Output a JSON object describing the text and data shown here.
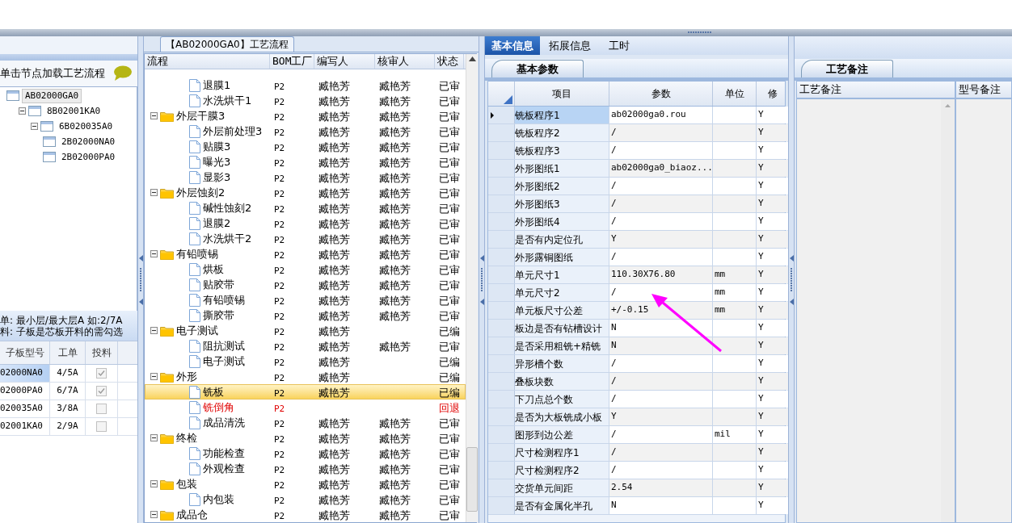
{
  "bom_tree": {
    "hint": "单击节点加载工艺流程",
    "nodes": [
      {
        "code": "AB02000GA0",
        "selected": true,
        "children": [
          {
            "code": "8B02001KA0",
            "selected": false,
            "children": [
              {
                "code": "6B020035A0",
                "selected": false,
                "children": [
                  {
                    "code": "2B02000NA0",
                    "selected": false
                  },
                  {
                    "code": "2B02000PA0",
                    "selected": false
                  }
                ]
              }
            ]
          }
        ]
      }
    ]
  },
  "sub_boards": {
    "notes": [
      "单: 最小层/最大层A 如:2/7A",
      "料: 子板是芯板开料的需勾选"
    ],
    "columns": [
      "子板型号",
      "工单",
      "投料"
    ],
    "rows": [
      {
        "model": "02000NA0",
        "order": "4/5A",
        "checked": true
      },
      {
        "model": "02000PA0",
        "order": "6/7A",
        "checked": true
      },
      {
        "model": "020035A0",
        "order": "3/8A",
        "checked": false
      },
      {
        "model": "02001KA0",
        "order": "2/9A",
        "checked": false
      }
    ]
  },
  "process_flow": {
    "title": "【AB02000GA0】工艺流程",
    "columns": [
      "流程",
      "BOM工厂",
      "编写人",
      "核审人",
      "状态"
    ],
    "steps": [
      {
        "kind": "group",
        "children": [
          {
            "kind": "step",
            "name": "退膜1",
            "factory": "P2",
            "writer": "臧艳芳",
            "reviewer": "臧艳芳",
            "status": "已审",
            "selected": false,
            "returned": false
          },
          {
            "kind": "step",
            "name": "水洗烘干1",
            "factory": "P2",
            "writer": "臧艳芳",
            "reviewer": "臧艳芳",
            "status": "已审",
            "selected": false,
            "returned": false
          }
        ]
      },
      {
        "kind": "folder",
        "name": "外层干膜3",
        "factory": "P2",
        "writer": "臧艳芳",
        "reviewer": "臧艳芳",
        "status": "已审",
        "selected": false,
        "returned": false,
        "expanded": true,
        "children": [
          {
            "kind": "step",
            "name": "外层前处理3",
            "factory": "P2",
            "writer": "臧艳芳",
            "reviewer": "臧艳芳",
            "status": "已审",
            "selected": false,
            "returned": false
          },
          {
            "kind": "step",
            "name": "贴膜3",
            "factory": "P2",
            "writer": "臧艳芳",
            "reviewer": "臧艳芳",
            "status": "已审",
            "selected": false,
            "returned": false
          },
          {
            "kind": "step",
            "name": "曝光3",
            "factory": "P2",
            "writer": "臧艳芳",
            "reviewer": "臧艳芳",
            "status": "已审",
            "selected": false,
            "returned": false
          },
          {
            "kind": "step",
            "name": "显影3",
            "factory": "P2",
            "writer": "臧艳芳",
            "reviewer": "臧艳芳",
            "status": "已审",
            "selected": false,
            "returned": false
          }
        ]
      },
      {
        "kind": "folder",
        "name": "外层蚀刻2",
        "factory": "P2",
        "writer": "臧艳芳",
        "reviewer": "臧艳芳",
        "status": "已审",
        "selected": false,
        "returned": false,
        "expanded": true,
        "children": [
          {
            "kind": "step",
            "name": "碱性蚀刻2",
            "factory": "P2",
            "writer": "臧艳芳",
            "reviewer": "臧艳芳",
            "status": "已审",
            "selected": false,
            "returned": false
          },
          {
            "kind": "step",
            "name": "退膜2",
            "factory": "P2",
            "writer": "臧艳芳",
            "reviewer": "臧艳芳",
            "status": "已审",
            "selected": false,
            "returned": false
          },
          {
            "kind": "step",
            "name": "水洗烘干2",
            "factory": "P2",
            "writer": "臧艳芳",
            "reviewer": "臧艳芳",
            "status": "已审",
            "selected": false,
            "returned": false
          }
        ]
      },
      {
        "kind": "folder",
        "name": "有铅喷锡",
        "factory": "P2",
        "writer": "臧艳芳",
        "reviewer": "臧艳芳",
        "status": "已审",
        "selected": false,
        "returned": false,
        "expanded": true,
        "children": [
          {
            "kind": "step",
            "name": "烘板",
            "factory": "P2",
            "writer": "臧艳芳",
            "reviewer": "臧艳芳",
            "status": "已审",
            "selected": false,
            "returned": false
          },
          {
            "kind": "step",
            "name": "贴胶带",
            "factory": "P2",
            "writer": "臧艳芳",
            "reviewer": "臧艳芳",
            "status": "已审",
            "selected": false,
            "returned": false
          },
          {
            "kind": "step",
            "name": "有铅喷锡",
            "factory": "P2",
            "writer": "臧艳芳",
            "reviewer": "臧艳芳",
            "status": "已审",
            "selected": false,
            "returned": false
          },
          {
            "kind": "step",
            "name": "撕胶带",
            "factory": "P2",
            "writer": "臧艳芳",
            "reviewer": "臧艳芳",
            "status": "已审",
            "selected": false,
            "returned": false
          }
        ]
      },
      {
        "kind": "folder",
        "name": "电子测试",
        "factory": "P2",
        "writer": "臧艳芳",
        "status": "已编",
        "selected": false,
        "returned": false,
        "expanded": true,
        "children": [
          {
            "kind": "step",
            "name": "阻抗测试",
            "factory": "P2",
            "writer": "臧艳芳",
            "reviewer": "臧艳芳",
            "status": "已审",
            "selected": false,
            "returned": false
          },
          {
            "kind": "step",
            "name": "电子测试",
            "factory": "P2",
            "writer": "臧艳芳",
            "status": "已编",
            "selected": false,
            "returned": false
          }
        ]
      },
      {
        "kind": "folder",
        "name": "外形",
        "factory": "P2",
        "writer": "臧艳芳",
        "status": "已编",
        "selected": false,
        "returned": false,
        "expanded": true,
        "children": [
          {
            "kind": "step",
            "name": "铣板",
            "factory": "P2",
            "writer": "臧艳芳",
            "status": "已编",
            "selected": true,
            "returned": false
          },
          {
            "kind": "step",
            "name": "铣倒角",
            "factory": "P2",
            "status": "回退",
            "selected": false,
            "returned": true
          },
          {
            "kind": "step",
            "name": "成品清洗",
            "factory": "P2",
            "writer": "臧艳芳",
            "reviewer": "臧艳芳",
            "status": "已审",
            "selected": false,
            "returned": false
          }
        ]
      },
      {
        "kind": "folder",
        "name": "终检",
        "factory": "P2",
        "writer": "臧艳芳",
        "reviewer": "臧艳芳",
        "status": "已审",
        "selected": false,
        "returned": false,
        "expanded": true,
        "children": [
          {
            "kind": "step",
            "name": "功能检查",
            "factory": "P2",
            "writer": "臧艳芳",
            "reviewer": "臧艳芳",
            "status": "已审",
            "selected": false,
            "returned": false
          },
          {
            "kind": "step",
            "name": "外观检查",
            "factory": "P2",
            "writer": "臧艳芳",
            "reviewer": "臧艳芳",
            "status": "已审",
            "selected": false,
            "returned": false
          }
        ]
      },
      {
        "kind": "folder",
        "name": "包装",
        "factory": "P2",
        "writer": "臧艳芳",
        "reviewer": "臧艳芳",
        "status": "已审",
        "selected": false,
        "returned": false,
        "expanded": true,
        "children": [
          {
            "kind": "step",
            "name": "内包装",
            "factory": "P2",
            "writer": "臧艳芳",
            "reviewer": "臧艳芳",
            "status": "已审",
            "selected": false,
            "returned": false
          }
        ]
      },
      {
        "kind": "folder",
        "name": "成品仓",
        "factory": "P2",
        "writer": "臧艳芳",
        "reviewer": "臧艳芳",
        "status": "已审",
        "selected": false,
        "returned": false,
        "expanded": true
      }
    ]
  },
  "info_tabs": [
    {
      "label": "基本信息",
      "selected": true
    },
    {
      "label": "拓展信息",
      "selected": false
    },
    {
      "label": "工时",
      "selected": false
    }
  ],
  "parameters": {
    "tab": "基本参数",
    "columns": [
      "项目",
      "参数",
      "单位",
      "修"
    ],
    "rows": [
      {
        "item": "铣板程序1",
        "value": "ab02000ga0.rou",
        "modify": "Y",
        "selected": true
      },
      {
        "item": "铣板程序2",
        "value": "/",
        "modify": "Y",
        "selected": false
      },
      {
        "item": "铣板程序3",
        "value": "/",
        "modify": "Y",
        "selected": false
      },
      {
        "item": "外形图纸1",
        "value": "ab02000ga0_biaoz...",
        "modify": "Y",
        "selected": false
      },
      {
        "item": "外形图纸2",
        "value": "/",
        "modify": "Y",
        "selected": false
      },
      {
        "item": "外形图纸3",
        "value": "/",
        "modify": "Y",
        "selected": false
      },
      {
        "item": "外形图纸4",
        "value": "/",
        "modify": "Y",
        "selected": false
      },
      {
        "item": "是否有内定位孔",
        "value": "Y",
        "modify": "Y",
        "selected": false
      },
      {
        "item": "外形露铜图纸",
        "value": "/",
        "modify": "Y",
        "selected": false
      },
      {
        "item": "单元尺寸1",
        "value": "110.30X76.80",
        "unit": "mm",
        "modify": "Y",
        "selected": false
      },
      {
        "item": "单元尺寸2",
        "value": "/",
        "unit": "mm",
        "modify": "Y",
        "selected": false
      },
      {
        "item": "单元板尺寸公差",
        "value": "+/-0.15",
        "unit": "mm",
        "modify": "Y",
        "selected": false
      },
      {
        "item": "板边是否有钻槽设计",
        "value": "N",
        "modify": "Y",
        "selected": false
      },
      {
        "item": "是否采用粗铣+精铣",
        "value": "N",
        "modify": "Y",
        "selected": false
      },
      {
        "item": "异形槽个数",
        "value": "/",
        "modify": "Y",
        "selected": false
      },
      {
        "item": "叠板块数",
        "value": "/",
        "modify": "Y",
        "selected": false
      },
      {
        "item": "下刀点总个数",
        "value": "/",
        "modify": "Y",
        "selected": false
      },
      {
        "item": "是否为大板铣成小板",
        "value": "Y",
        "modify": "Y",
        "selected": false
      },
      {
        "item": "图形到边公差",
        "value": "/",
        "unit": "mil",
        "modify": "Y",
        "selected": false
      },
      {
        "item": "尺寸检测程序1",
        "value": "/",
        "modify": "Y",
        "selected": false
      },
      {
        "item": "尺寸检测程序2",
        "value": "/",
        "modify": "Y",
        "selected": false
      },
      {
        "item": "交货单元间距",
        "value": "2.54",
        "modify": "Y",
        "selected": false
      },
      {
        "item": "是否有金属化半孔",
        "value": "N",
        "modify": "Y",
        "selected": false
      }
    ]
  },
  "remarks": {
    "tab": "工艺备注",
    "columns": [
      "工艺备注",
      "型号备注"
    ]
  }
}
